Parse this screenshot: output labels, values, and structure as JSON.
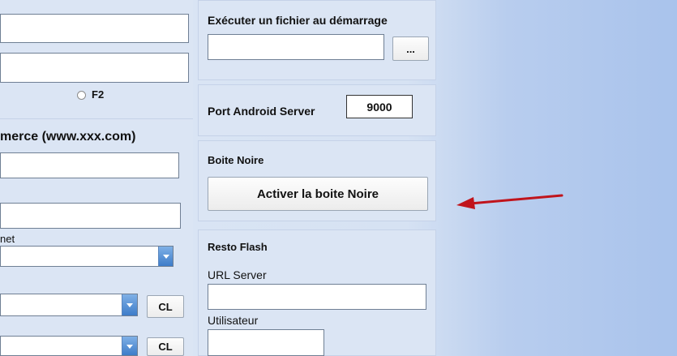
{
  "left": {
    "f2_label": "F2",
    "ecommerce_title": "merce (www.xxx.com)",
    "net_label": "net",
    "cl1_label": "CL",
    "cl2_label": "CL"
  },
  "startup": {
    "title": "Exécuter un fichier au démarrage",
    "browse_label": "..."
  },
  "android": {
    "label": "Port Android Server",
    "port_value": "9000"
  },
  "black_box": {
    "title": "Boite Noire",
    "activate_label": "Activer la boite Noire"
  },
  "resto_flash": {
    "title": "Resto Flash",
    "url_label": "URL Server",
    "url_value": "",
    "user_label": "Utilisateur",
    "user_value": ""
  },
  "annotation": {
    "arrow_color": "#c0141c"
  }
}
